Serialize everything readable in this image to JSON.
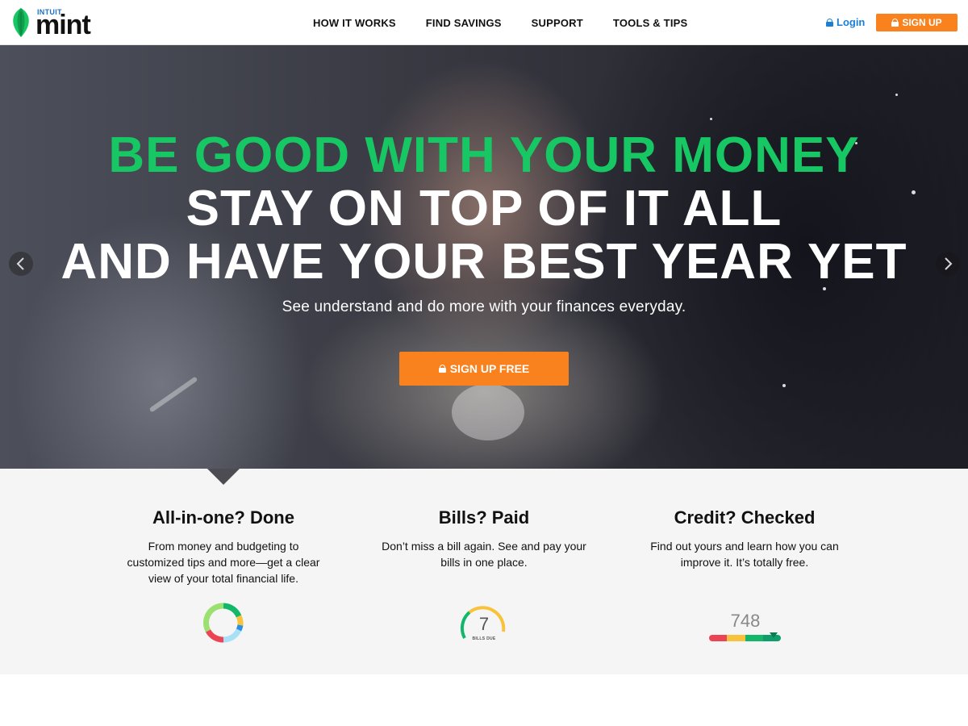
{
  "header": {
    "logo": {
      "brand_small": "INTUIT",
      "brand": "mint"
    },
    "nav": [
      "HOW IT WORKS",
      "FIND SAVINGS",
      "SUPPORT",
      "TOOLS & TIPS"
    ],
    "login_label": "Login",
    "signup_label": "SIGN UP"
  },
  "hero": {
    "headline_1": "BE GOOD WITH YOUR MONEY",
    "headline_2": "STAY ON TOP OF IT ALL",
    "headline_3": "AND HAVE YOUR BEST YEAR YET",
    "subtitle": "See understand and do more with your finances everyday.",
    "cta_label": "SIGN UP FREE",
    "prev_icon": "chevron-left-icon",
    "next_icon": "chevron-right-icon"
  },
  "features": [
    {
      "title": "All-in-one? Done",
      "desc": "From money and budgeting to customized tips and more—get a clear view of your total financial life.",
      "icon": "donut-chart-icon"
    },
    {
      "title": "Bills? Paid",
      "desc": "Don’t miss a bill again. See and pay your bills in one place.",
      "icon": "bills-gauge-icon",
      "gauge_value": "7",
      "gauge_label": "BILLS DUE"
    },
    {
      "title": "Credit? Checked",
      "desc": "Find out yours and learn how you can improve it. It’s totally free.",
      "icon": "credit-score-icon",
      "score": "748"
    }
  ],
  "colors": {
    "brand_green": "#16c764",
    "accent_orange": "#f9821e",
    "link_blue": "#1a7fd6"
  }
}
